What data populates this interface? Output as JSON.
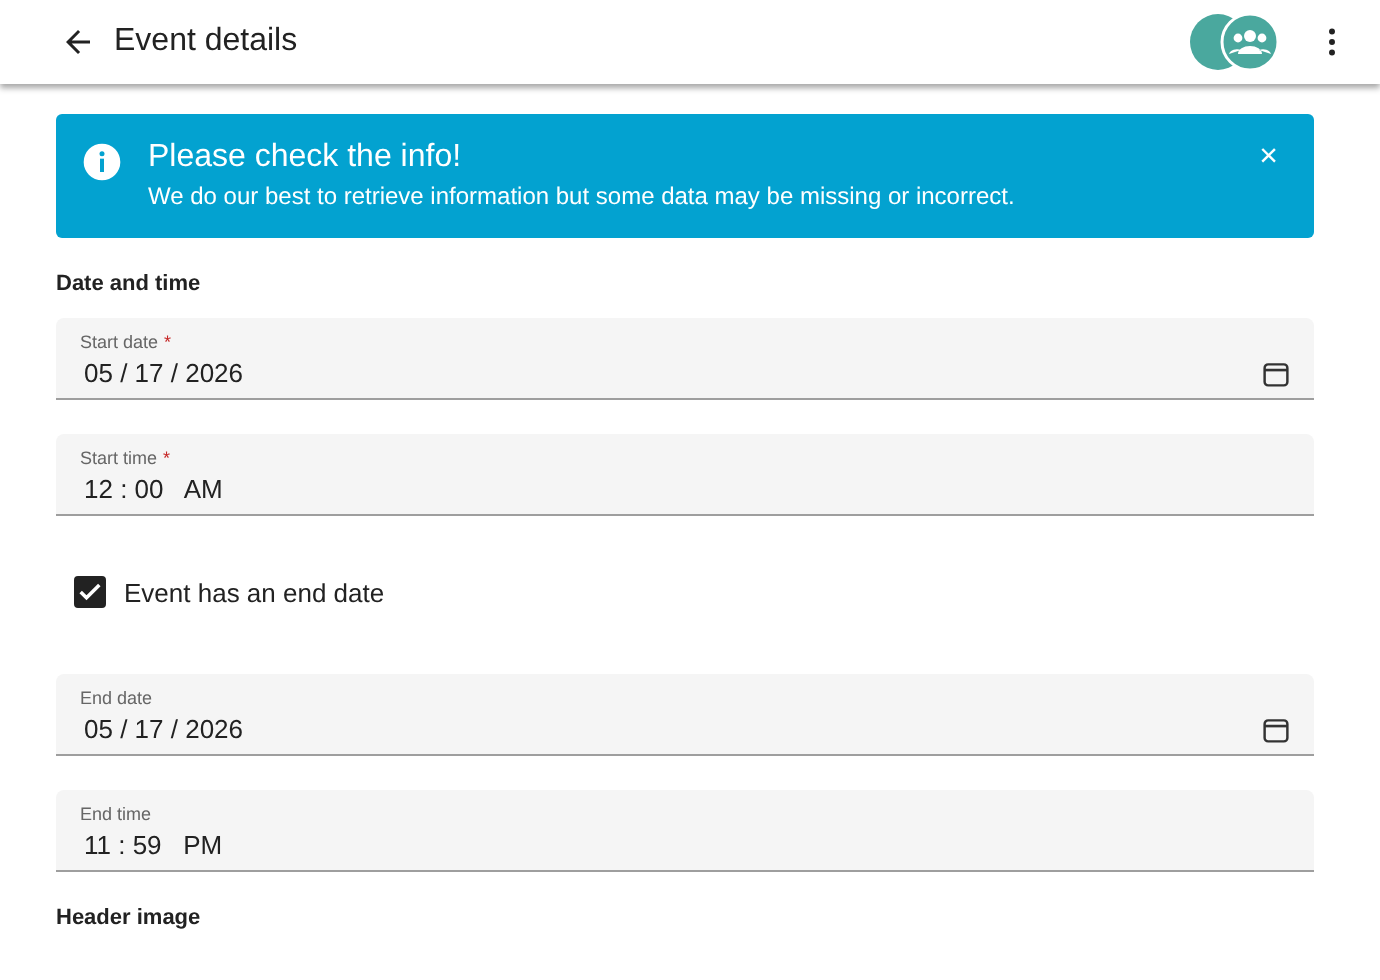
{
  "app_bar": {
    "title": "Event details"
  },
  "alert": {
    "title": "Please check the info!",
    "message": "We do our best to retrieve information but some data may be missing or incorrect.",
    "close": "×"
  },
  "sections": [
    {
      "heading": "Date and time",
      "items": [
        {
          "kind": "date",
          "label": "Start date",
          "required_mark": "*",
          "value": "05 / 17 / 2026"
        },
        {
          "kind": "time",
          "label": "Start time",
          "required_mark": "*",
          "value": "12 : 00   AM"
        },
        {
          "kind": "checkbox",
          "label": "Event has an end date",
          "checked": true
        },
        {
          "kind": "date",
          "label": "End date",
          "value": "05 / 17 / 2026"
        },
        {
          "kind": "time",
          "label": "End time",
          "value": "11 : 59   PM"
        }
      ]
    },
    {
      "heading": "Header image"
    }
  ]
}
